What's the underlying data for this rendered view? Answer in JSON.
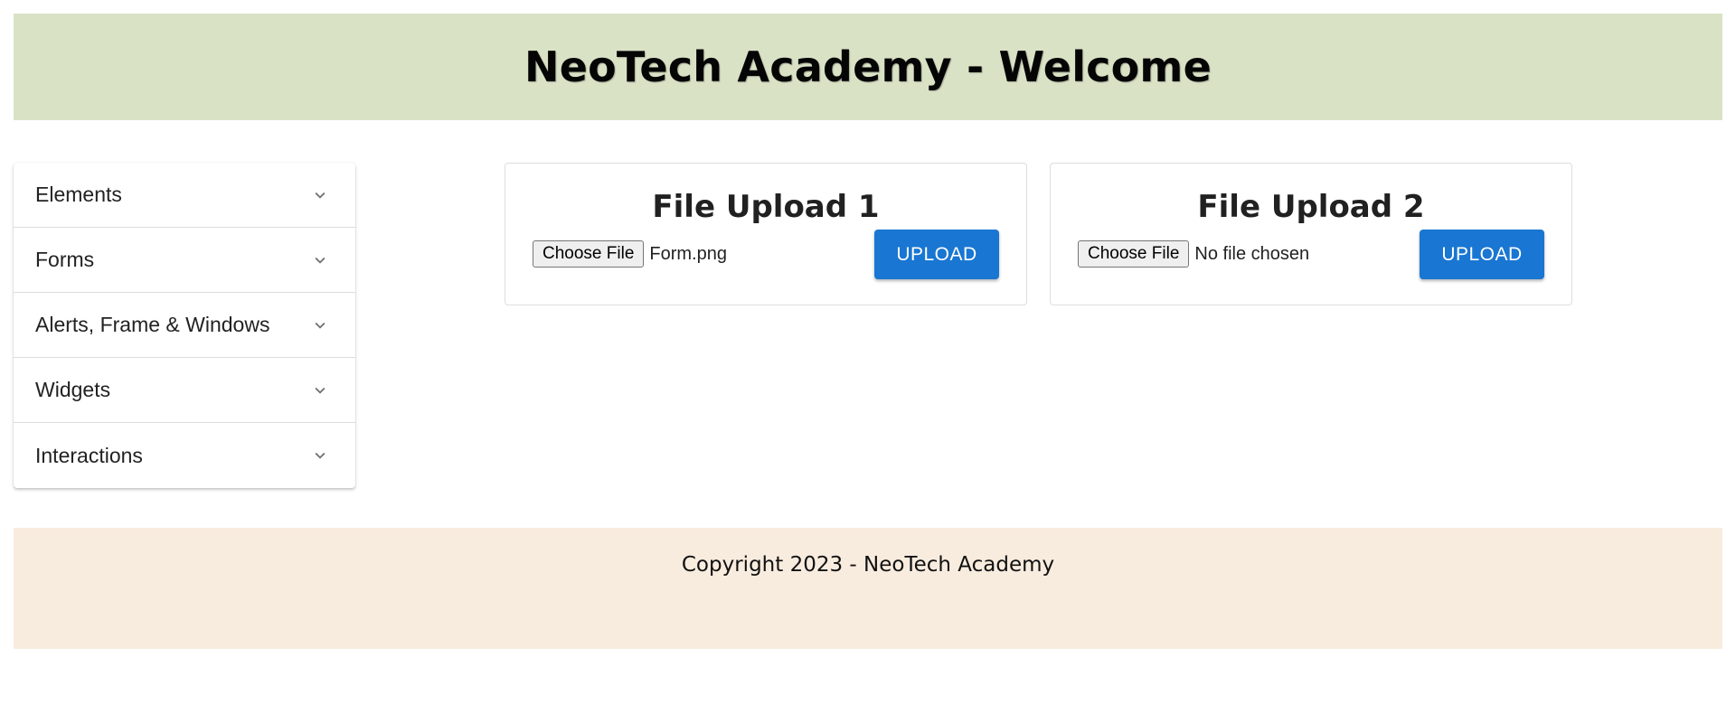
{
  "header": {
    "title": "NeoTech Academy - Welcome"
  },
  "sidebar": {
    "items": [
      {
        "label": "Elements",
        "icon": "chevron-down-icon"
      },
      {
        "label": "Forms",
        "icon": "chevron-down-icon"
      },
      {
        "label": "Alerts, Frame & Windows",
        "icon": "chevron-down-icon"
      },
      {
        "label": "Widgets",
        "icon": "chevron-down-icon"
      },
      {
        "label": "Interactions",
        "icon": "chevron-down-icon"
      }
    ]
  },
  "uploads": [
    {
      "title": "File Upload 1",
      "choose_label": "Choose File",
      "file_status": "Form.png",
      "upload_label": "UPLOAD"
    },
    {
      "title": "File Upload 2",
      "choose_label": "Choose File",
      "file_status": "No file chosen",
      "upload_label": "UPLOAD"
    }
  ],
  "footer": {
    "text": "Copyright 2023 - NeoTech Academy"
  },
  "colors": {
    "header_bg": "#dae2c6",
    "footer_bg": "#f8ecdf",
    "accent": "#1976d2"
  }
}
